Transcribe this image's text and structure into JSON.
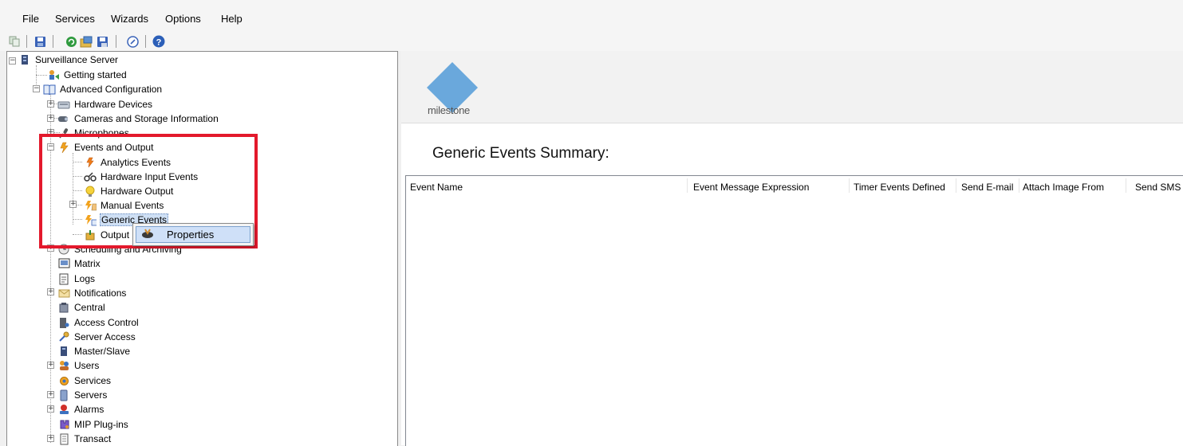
{
  "menu": [
    "File",
    "Services",
    "Wizards",
    "Options",
    "Help"
  ],
  "toolbar": {
    "icons": [
      "copy-icon",
      "save-icon",
      "refresh-icon",
      "export-icon",
      "save-config-icon",
      "link-icon",
      "help-icon"
    ]
  },
  "tree": {
    "root": "Surveillance Server",
    "getting_started": "Getting started",
    "advanced": "Advanced Configuration",
    "hardware_devices": "Hardware Devices",
    "cameras_storage": "Cameras and Storage Information",
    "microphones": "Microphones",
    "events_output": "Events and Output",
    "analytics_events": "Analytics Events",
    "hardware_input_events": "Hardware Input Events",
    "hardware_output": "Hardware Output",
    "manual_events": "Manual Events",
    "generic_events": "Generic Events",
    "output": "Output",
    "scheduling": "Scheduling and Archiving",
    "matrix": "Matrix",
    "logs": "Logs",
    "notifications": "Notifications",
    "central": "Central",
    "access_control": "Access Control",
    "server_access": "Server Access",
    "master_slave": "Master/Slave",
    "users": "Users",
    "services": "Services",
    "servers": "Servers",
    "alarms": "Alarms",
    "mip_plugins": "MIP Plug-ins",
    "transact": "Transact"
  },
  "context_menu": {
    "properties": "Properties"
  },
  "logo": {
    "text": "milestone",
    "color": "#6aa8dc"
  },
  "summary": {
    "title": "Generic Events Summary:",
    "columns": [
      "Event Name",
      "Event Message Expression",
      "Timer Events Defined",
      "Send E-mail",
      "Attach Image From",
      "Send SMS"
    ]
  },
  "colors": {
    "highlight": "#e3192c",
    "selection": "#cfe0f5"
  }
}
